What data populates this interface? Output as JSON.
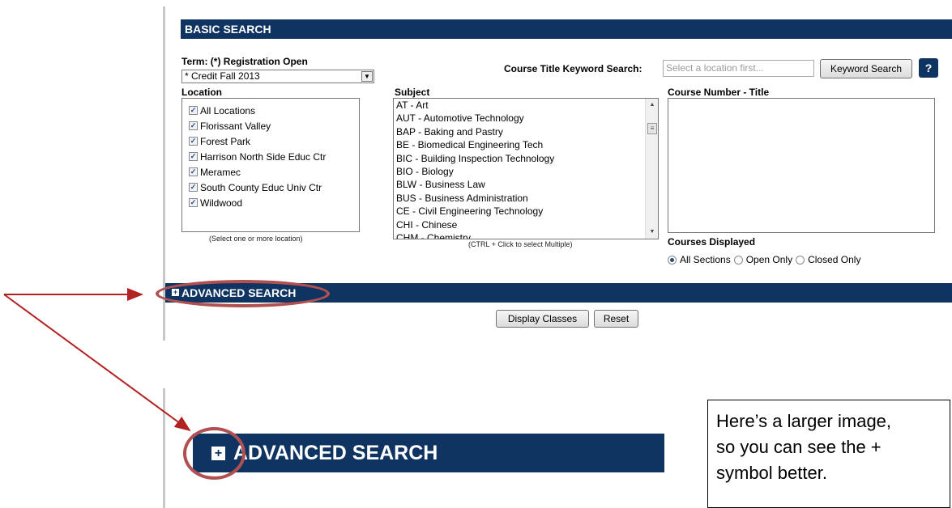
{
  "basic_search": {
    "header": "BASIC SEARCH",
    "term": {
      "label": "Term: (*) Registration Open",
      "selected": "* Credit Fall 2013"
    },
    "keyword": {
      "label": "Course Title Keyword Search:",
      "placeholder": "Select a location first...",
      "button_label": "Keyword Search",
      "help_icon": "?"
    },
    "location": {
      "label": "Location",
      "items": [
        "All Locations",
        "Florissant Valley",
        "Forest Park",
        "Harrison North Side Educ Ctr",
        "Meramec",
        "South County Educ Univ Ctr",
        "Wildwood"
      ],
      "hint": "(Select one or more location)"
    },
    "subject": {
      "label": "Subject",
      "items": [
        "AT - Art",
        "AUT - Automotive Technology",
        "BAP - Baking and Pastry",
        "BE - Biomedical Engineering Tech",
        "BIC - Building Inspection Technology",
        "BIO - Biology",
        "BLW - Business Law",
        "BUS - Business Administration",
        "CE - Civil Engineering Technology",
        "CHI - Chinese",
        "CHM - Chemistry"
      ],
      "hint": "(CTRL + Click to select Multiple)"
    },
    "course_number": {
      "label": "Course Number - Title"
    },
    "courses_displayed": {
      "label": "Courses Displayed",
      "options": [
        "All Sections",
        "Open Only",
        "Closed Only"
      ]
    }
  },
  "advanced_search": {
    "label": "ADVANCED SEARCH"
  },
  "buttons": {
    "display_classes": "Display Classes",
    "reset": "Reset"
  },
  "zoom": {
    "label": "ADVANCED SEARCH"
  },
  "note": {
    "lines": [
      "Here’s a larger image,",
      "so you can see the +",
      "symbol better."
    ]
  },
  "colors": {
    "header_navy": "#0f3461",
    "annotation_red": "#b05050",
    "arrow_red": "#b22222"
  }
}
